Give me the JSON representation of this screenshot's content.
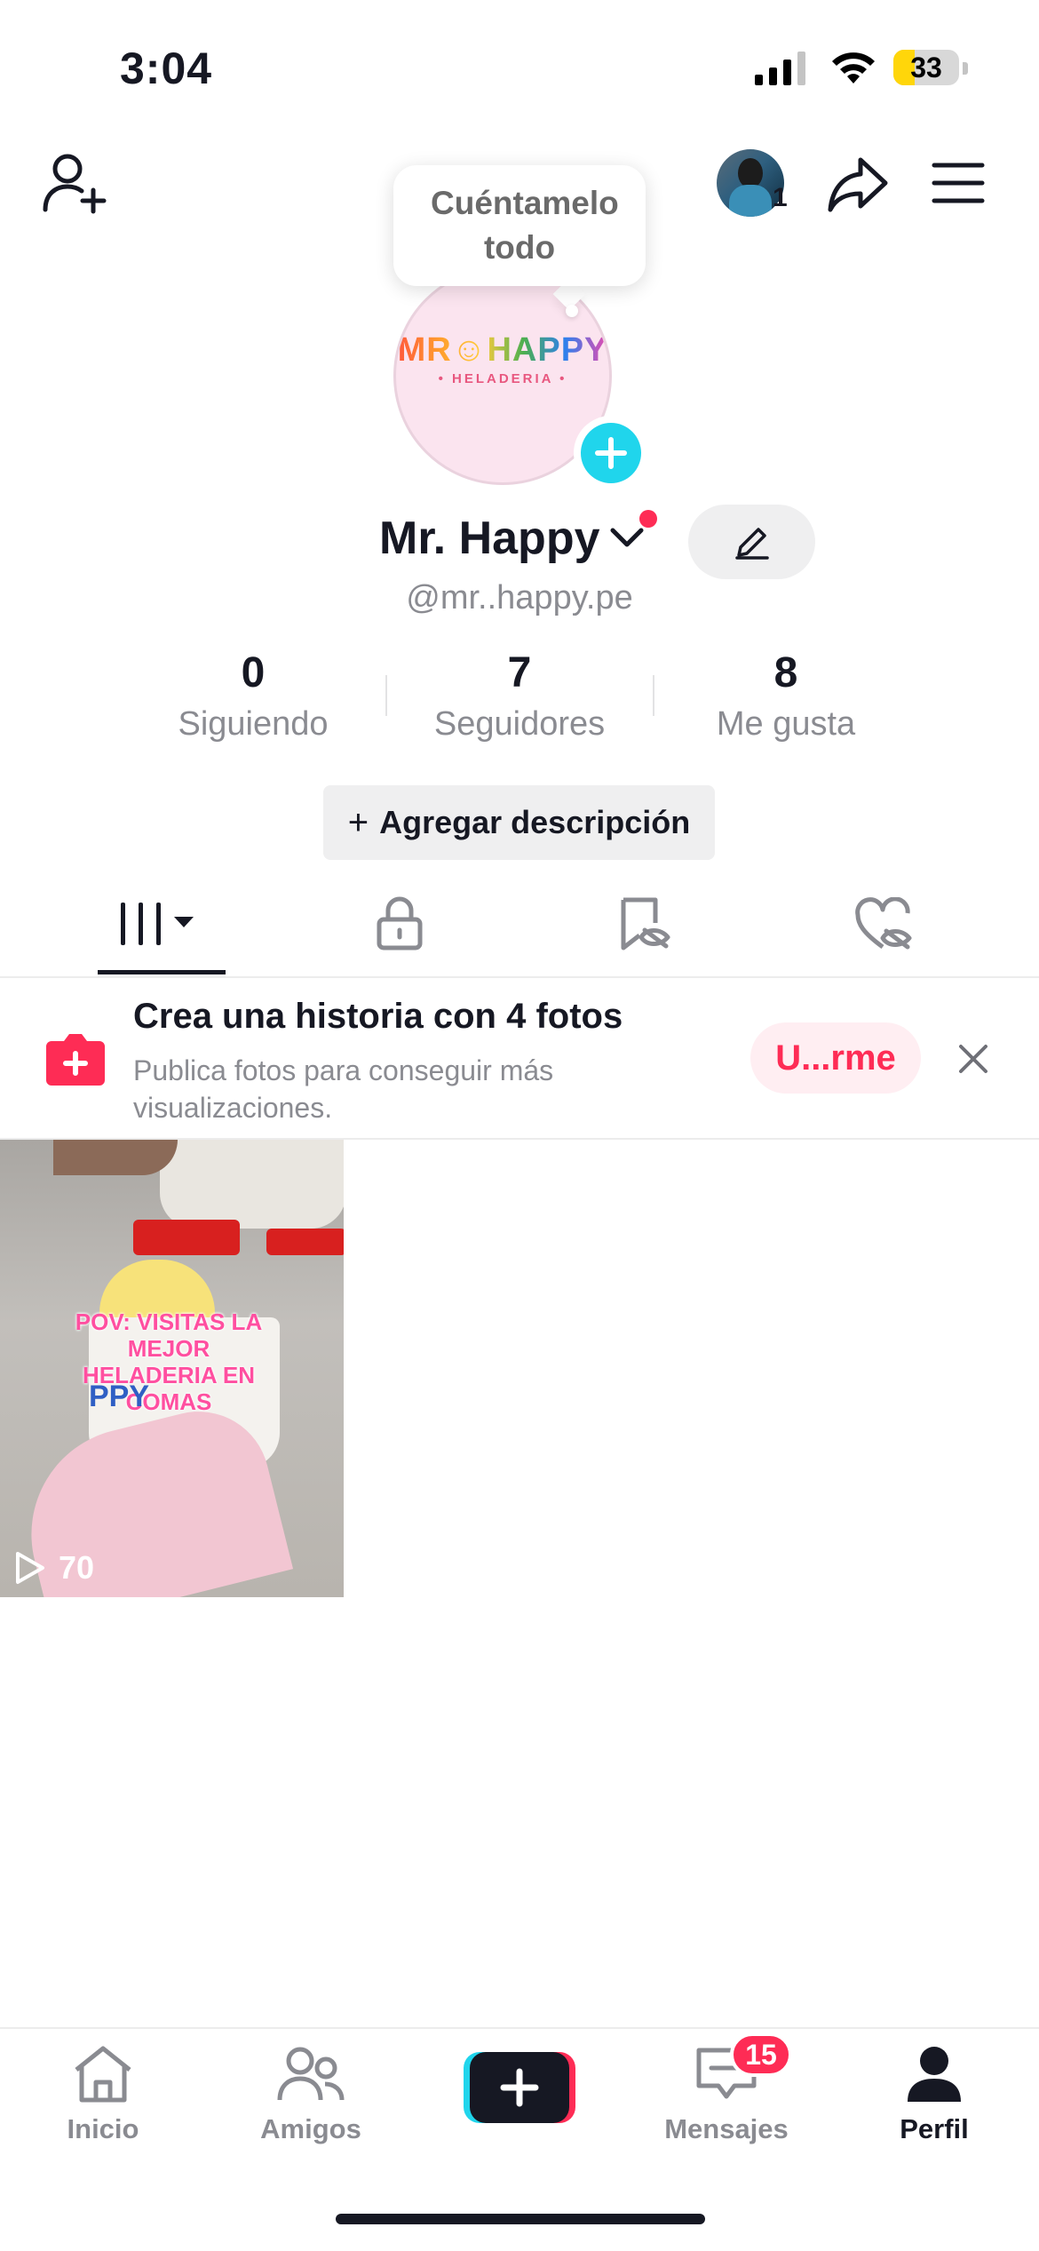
{
  "status_bar": {
    "time": "3:04",
    "battery": "33"
  },
  "header": {
    "tooltip": "Cuéntamelo todo",
    "avatar_badge": "1",
    "logo_text": "MR☺HAPPY",
    "logo_sub": "• HELADERIA •"
  },
  "profile": {
    "name": "Mr. Happy",
    "handle": "@mr..happy.pe",
    "stats": [
      {
        "value": "0",
        "label": "Siguiendo"
      },
      {
        "value": "7",
        "label": "Seguidores"
      },
      {
        "value": "8",
        "label": "Me gusta"
      }
    ],
    "add_description_plus": "+",
    "add_description": "Agregar descripción"
  },
  "banner": {
    "title": "Crea una historia con 4 fotos",
    "subtitle": "Publica fotos para conseguir más visualizaciones.",
    "action": "U...rme"
  },
  "videos": [
    {
      "caption": "POV: VISITAS LA MEJOR HELADERIA EN COMAS",
      "cup_text": "PPY",
      "views": "70"
    }
  ],
  "nav": {
    "items": [
      {
        "label": "Inicio"
      },
      {
        "label": "Amigos"
      },
      {
        "label": "Mensajes"
      },
      {
        "label": "Perfil"
      }
    ],
    "messages_badge": "15"
  },
  "colors": {
    "accent": "#fe2c55",
    "cyan": "#20d5ec",
    "text": "#161823",
    "muted": "#8a8b91"
  }
}
